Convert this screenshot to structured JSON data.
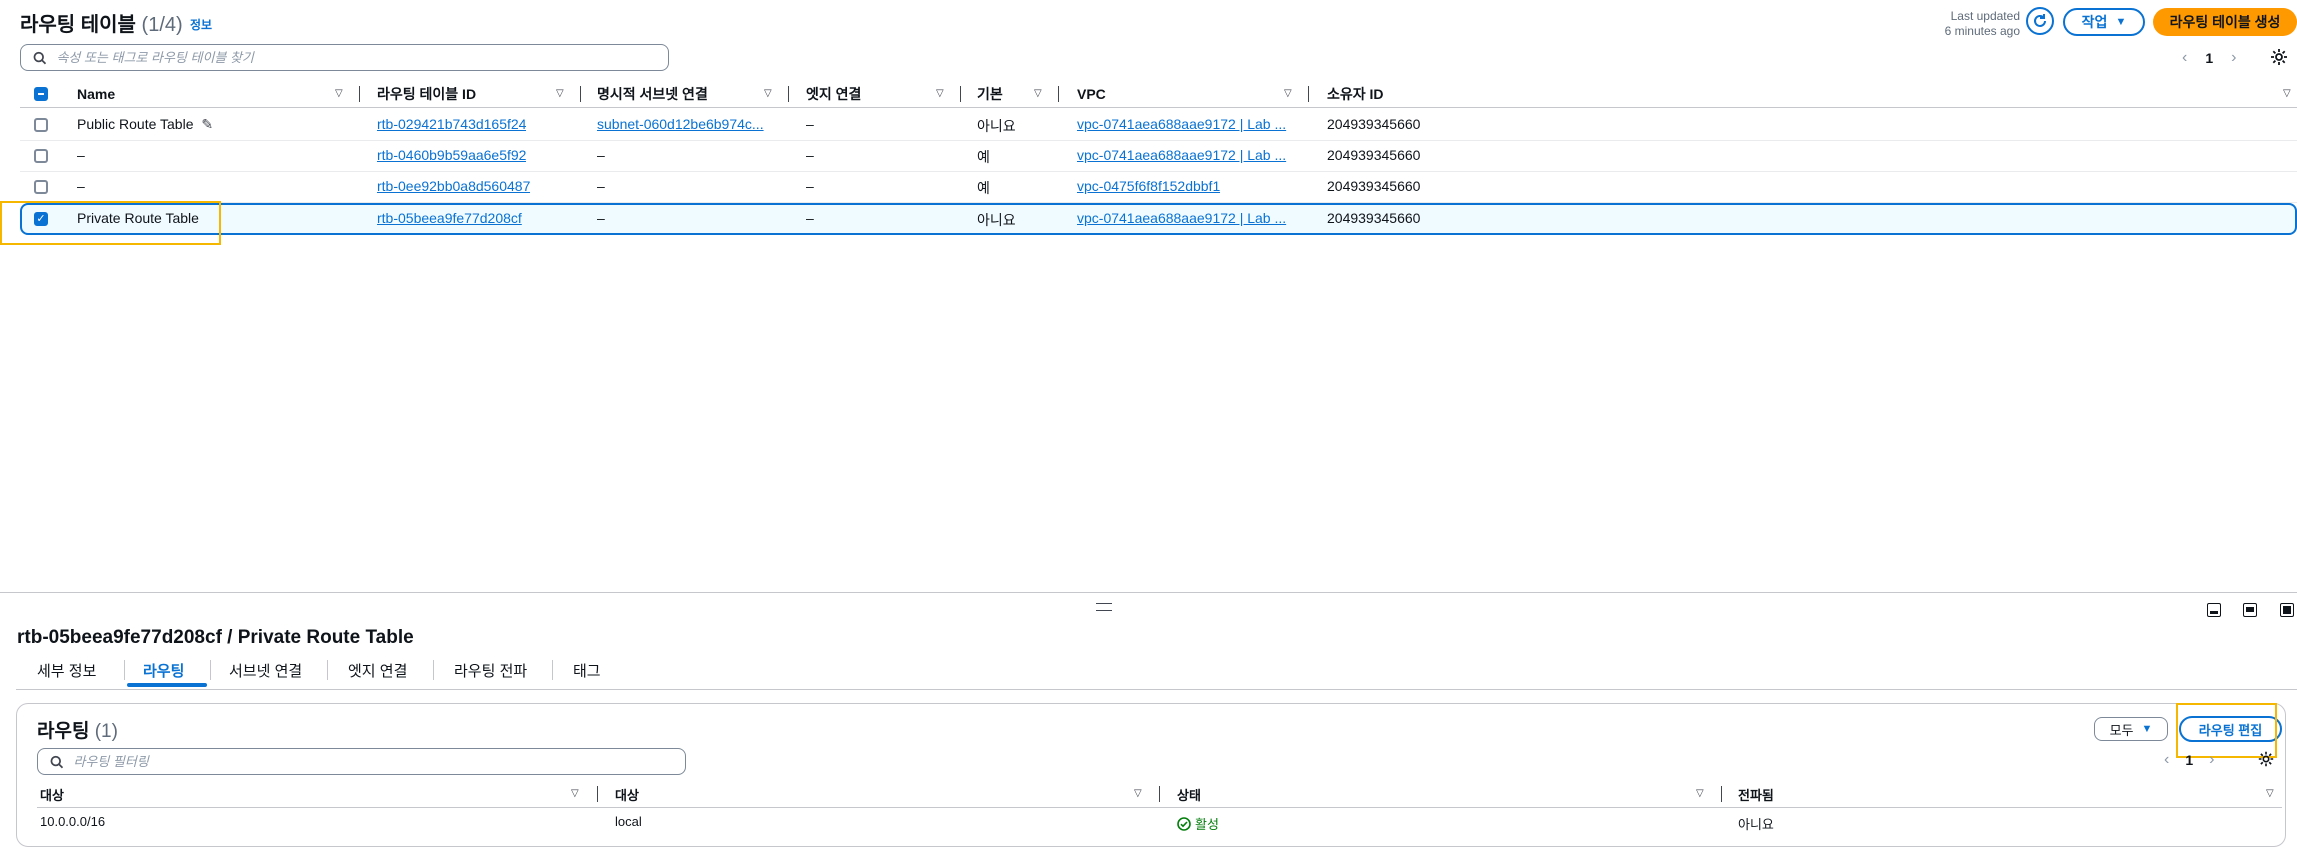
{
  "header": {
    "title": "라우팅 테이블",
    "count": "(1/4)",
    "info": "정보",
    "last_updated_line1": "Last updated",
    "last_updated_line2": "6 minutes ago",
    "actions_label": "작업",
    "create_label": "라우팅 테이블 생성"
  },
  "search": {
    "placeholder": "속성 또는 태그로 라우팅 테이블 찾기"
  },
  "pagination": {
    "page": "1"
  },
  "table": {
    "columns": [
      "Name",
      "라우팅 테이블 ID",
      "명시적 서브넷 연결",
      "엣지 연결",
      "기본",
      "VPC",
      "소유자 ID"
    ],
    "rows": [
      {
        "name": "Public Route Table",
        "id": "rtb-029421b743d165f24",
        "subnet": "subnet-060d12be6b974c...",
        "edge": "–",
        "main": "아니요",
        "vpc": "vpc-0741aea688aae9172 | Lab ...",
        "owner": "204939345660",
        "selected": false
      },
      {
        "name": "–",
        "id": "rtb-0460b9b59aa6e5f92",
        "subnet": "–",
        "edge": "–",
        "main": "예",
        "vpc": "vpc-0741aea688aae9172 | Lab ...",
        "owner": "204939345660",
        "selected": false
      },
      {
        "name": "–",
        "id": "rtb-0ee92bb0a8d560487",
        "subnet": "–",
        "edge": "–",
        "main": "예",
        "vpc": "vpc-0475f6f8f152dbbf1",
        "owner": "204939345660",
        "selected": false
      },
      {
        "name": "Private Route Table",
        "id": "rtb-05beea9fe77d208cf",
        "subnet": "–",
        "edge": "–",
        "main": "아니요",
        "vpc": "vpc-0741aea688aae9172 | Lab ...",
        "owner": "204939345660",
        "selected": true
      }
    ]
  },
  "detail": {
    "title": "rtb-05beea9fe77d208cf / Private Route Table",
    "tabs": [
      "세부 정보",
      "라우팅",
      "서브넷 연결",
      "엣지 연결",
      "라우팅 전파",
      "태그"
    ],
    "active_tab": "라우팅",
    "routes": {
      "title": "라우팅",
      "count": "(1)",
      "filter_select": "모두",
      "edit_label": "라우팅 편집",
      "filter_placeholder": "라우팅 필터링",
      "page": "1",
      "columns": [
        "대상",
        "대상",
        "상태",
        "전파됨"
      ],
      "rows": [
        {
          "destination": "10.0.0.0/16",
          "target": "local",
          "status": "활성",
          "propagated": "아니요"
        }
      ]
    }
  },
  "colors": {
    "accent": "#0972d3",
    "primary": "#ff9900",
    "highlight": "#f5b700",
    "success": "#037f0c"
  }
}
